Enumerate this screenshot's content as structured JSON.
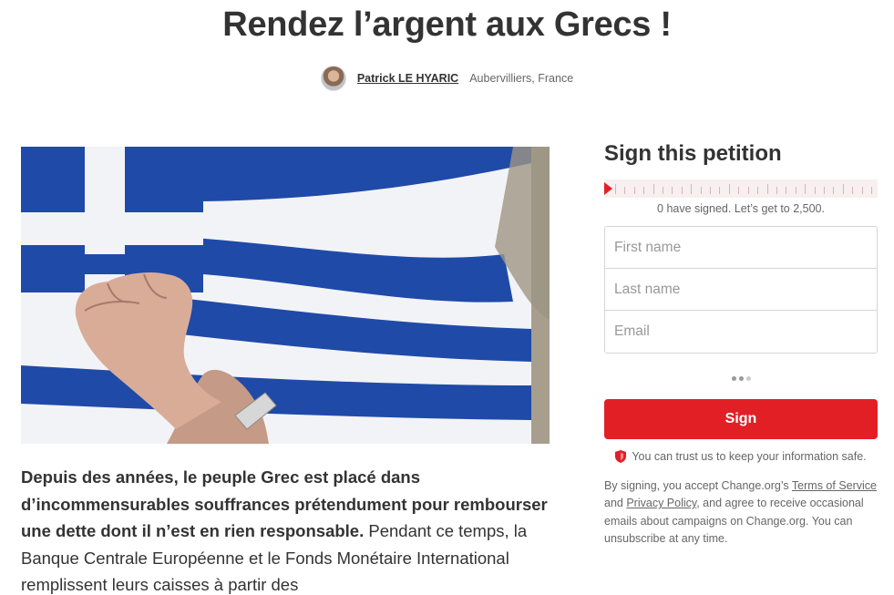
{
  "petition": {
    "title": "Rendez l’argent aux Grecs !",
    "author_name": "Patrick LE HYARIC",
    "author_location": "Aubervilliers, France",
    "body_bold": "Depuis des années, le peuple Grec est placé dans d’incommensurables souffrances prétendument pour rembourser une dette dont il n’est en rien responsable",
    "body_bold_end": ".",
    "body_rest": " Pendant ce temps, la Banque Centrale Européenne et le Fonds Monétaire International remplissent leurs caisses à partir des"
  },
  "sidebar": {
    "heading": "Sign this petition",
    "signed_text": "0 have signed. Let’s get to 2,500.",
    "signature_count": 0,
    "signature_goal": 2500,
    "first_name_placeholder": "First name",
    "last_name_placeholder": "Last name",
    "email_placeholder": "Email",
    "sign_button": "Sign",
    "trust_text": "You can trust us to keep your information safe.",
    "legal_prefix": "By signing, you accept Change.org’s ",
    "terms_link": "Terms of Service",
    "legal_and": " and ",
    "privacy_link": "Privacy Policy",
    "legal_suffix": ", and agree to receive occasional emails about campaigns on Change.org. You can unsubscribe at any time."
  },
  "colors": {
    "brand_red": "#e31f26",
    "flag_blue": "#1f4aa8"
  },
  "icons": {
    "trust": "shield-icon",
    "progress": "progress-marker-icon"
  }
}
